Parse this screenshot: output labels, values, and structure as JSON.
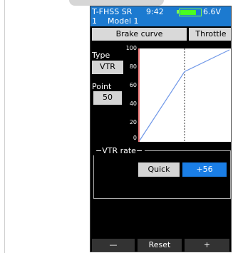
{
  "status": {
    "system": "T-FHSS SR",
    "time": "9:42",
    "voltage": "6.6V",
    "model_number": "1",
    "model_name": "Model 1",
    "battery_level": 0.8
  },
  "tabs": [
    {
      "label": "Brake curve",
      "selected": true
    },
    {
      "label": "Throttle",
      "selected": false
    }
  ],
  "type": {
    "label": "Type",
    "value": "VTR"
  },
  "point": {
    "label": "Point",
    "value": "50"
  },
  "chart_data": {
    "type": "line",
    "y_ticks": [
      "100",
      "80",
      "60",
      "40",
      "20",
      "0"
    ],
    "ylim": [
      0,
      100
    ],
    "xlim": [
      0,
      100
    ],
    "x": [
      0,
      50,
      100
    ],
    "y": [
      0,
      76,
      100
    ],
    "point_marker_x": 50,
    "line_color": "#6f97e8",
    "background": "#ffffff"
  },
  "vtr_rate": {
    "title": "VTR rate",
    "mode": "Quick",
    "value": "+56"
  },
  "footer": {
    "minus": "—",
    "reset": "Reset",
    "plus": "+"
  },
  "colors": {
    "status_bar": "#1c7ad0",
    "accent": "#1a7ee6",
    "battery": "#48ff22"
  }
}
